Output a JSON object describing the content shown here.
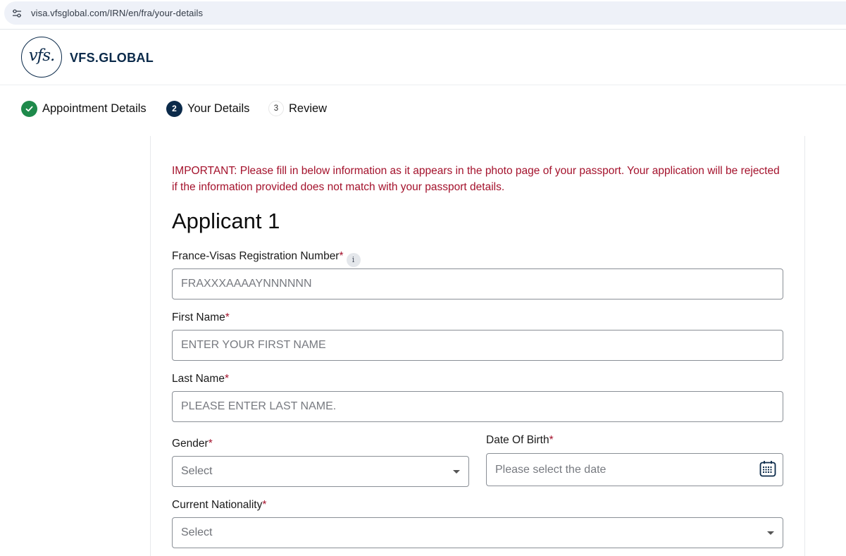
{
  "browser": {
    "url": "visa.vfsglobal.com/IRN/en/fra/your-details"
  },
  "header": {
    "logo_text": "vfs.",
    "brand": "VFS.GLOBAL"
  },
  "stepper": {
    "steps": [
      {
        "marker": "",
        "label": "Appointment Details",
        "state": "done"
      },
      {
        "marker": "2",
        "label": "Your Details",
        "state": "active"
      },
      {
        "marker": "3",
        "label": "Review",
        "state": "todo"
      }
    ]
  },
  "form": {
    "notice": "IMPORTANT: Please fill in below information as it appears in the photo page of your passport. Your application will be rejected if the information provided does not match with your passport details.",
    "applicant_title": "Applicant 1",
    "required_mark": "*",
    "registration": {
      "label": "France-Visas Registration Number",
      "info_icon": "i",
      "placeholder": "FRAXXXAAAAYNNNNNN"
    },
    "first_name": {
      "label": "First Name",
      "placeholder": "ENTER YOUR FIRST NAME"
    },
    "last_name": {
      "label": "Last Name",
      "placeholder": "PLEASE ENTER LAST NAME."
    },
    "gender": {
      "label": "Gender",
      "selected": "Select"
    },
    "dob": {
      "label": "Date Of Birth",
      "placeholder": "Please select the date"
    },
    "nationality": {
      "label": "Current Nationality",
      "selected": "Select"
    }
  },
  "icons": {
    "site_info": "tune-icon",
    "step_done": "check-icon",
    "info": "info-icon",
    "dropdown": "chevron-down-icon",
    "calendar": "calendar-icon"
  },
  "colors": {
    "brand": "#0b2a4a",
    "success": "#1e8a4b",
    "danger": "#a4122c"
  }
}
